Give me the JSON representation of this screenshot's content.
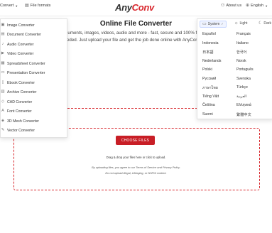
{
  "header": {
    "convert_label": "Convert",
    "file_formats_label": "File formats",
    "logo_left": "Any",
    "logo_right": "Conv",
    "about_label": "About us",
    "language_label": "English"
  },
  "main": {
    "title": "Online File Converter",
    "subtitle": "Convert documents, images, videos, audio and more - fast, secure and 100% free. No software needed. Just upload your file and get the job done online with AnyConv."
  },
  "convert_menu": {
    "items": [
      {
        "label": "Image Converter",
        "icon": "image-icon"
      },
      {
        "label": "Document Converter",
        "icon": "document-icon"
      },
      {
        "label": "Audio Converter",
        "icon": "audio-icon"
      },
      {
        "label": "Video Converter",
        "icon": "video-icon"
      },
      {
        "label": "Spreadsheet Converter",
        "icon": "spreadsheet-icon"
      },
      {
        "label": "Presentation Converter",
        "icon": "presentation-icon"
      },
      {
        "label": "Ebook Converter",
        "icon": "ebook-icon"
      },
      {
        "label": "Archive Converter",
        "icon": "archive-icon"
      },
      {
        "label": "CAD Converter",
        "icon": "cad-icon"
      },
      {
        "label": "Font Converter",
        "icon": "font-icon"
      },
      {
        "label": "3D Mesh Converter",
        "icon": "mesh-icon"
      },
      {
        "label": "Vector Converter",
        "icon": "vector-icon"
      }
    ]
  },
  "language_menu": {
    "theme_system": "System",
    "theme_light": "Light",
    "theme_dark": "Dark",
    "languages_left": [
      "Español",
      "Indonesia",
      "日本語",
      "Nederlands",
      "Polski",
      "Русский",
      "ภาษาไทย",
      "Tiếng Việt",
      "Čeština",
      "Suomi"
    ],
    "languages_right": [
      "Français",
      "Italiano",
      "한국어",
      "Norsk",
      "Português",
      "Svenska",
      "Türkçe",
      "العربية",
      "Ελληνικά",
      "繁體中文"
    ]
  },
  "upload": {
    "button_label": "CHOOSE FILES",
    "drag_text": "Drag & drop your files here or click to upload.",
    "terms_text": "By uploading files, you agree to our Terms of Service and Privacy Policy.",
    "illegal_text": "Do not upload illegal, infringing, or NSFW content."
  },
  "colors": {
    "accent": "#d8262c",
    "button": "#c81e26"
  }
}
